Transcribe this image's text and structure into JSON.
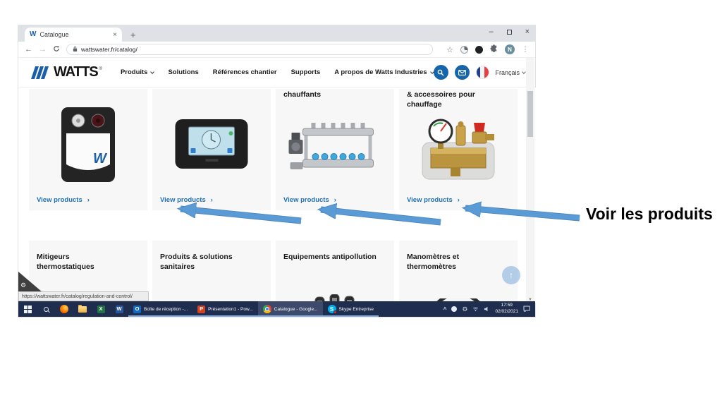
{
  "annotation": {
    "label": "Voir les produits"
  },
  "browser": {
    "tab_title": "Catalogue",
    "favicon_letter": "W",
    "url": "wattswater.fr/catalog/",
    "profile_initial": "N",
    "status_link": "https://wattswater.fr/catalog/regulation-and-control/"
  },
  "site": {
    "logo_text": "WATTS",
    "logo_reg": "®",
    "nav": [
      {
        "label": "Produits"
      },
      {
        "label": "Solutions"
      },
      {
        "label": "Références chantier"
      },
      {
        "label": "Supports"
      },
      {
        "label": "A propos de Watts Industries"
      }
    ],
    "language": {
      "label": "Français"
    }
  },
  "catalog": {
    "view_products_label": "View products",
    "row1": [
      {
        "title": ""
      },
      {
        "title": ""
      },
      {
        "title": "chauffants"
      },
      {
        "title": "& accessoires pour\nchauffage"
      }
    ],
    "row2": [
      {
        "title": "Mitigeurs\nthermostatiques"
      },
      {
        "title": "Produits & solutions\nsanitaires"
      },
      {
        "title": "Equipements antipollution"
      },
      {
        "title": "Manomètres et\nthermomètres"
      }
    ]
  },
  "taskbar": {
    "apps": [
      {
        "label": "Boîte de réception -..."
      },
      {
        "label": "Présentation1 - Pow..."
      },
      {
        "label": "Catalogue - Google..."
      },
      {
        "label": "Skype Entreprise"
      }
    ],
    "app_icons": {
      "excel": "X",
      "word": "W",
      "outlook": "O",
      "powerpoint": "P",
      "skype": "S"
    },
    "clock": {
      "time": "17:59",
      "date": "02/02/2021"
    }
  },
  "icons": {
    "close": "×",
    "plus": "+",
    "minimize": "–",
    "back": "←",
    "forward": "→",
    "star": "☆",
    "menu": "⋮",
    "chevron_right": "›",
    "up": "↑",
    "caret": "^",
    "scroll_down": "▼",
    "gear": "⚙"
  },
  "colors": {
    "accent_blue": "#1565ad",
    "link_blue": "#1d70b7",
    "arrow_blue": "#5b9bd5",
    "taskbar_navy": "#1f2d4e"
  }
}
